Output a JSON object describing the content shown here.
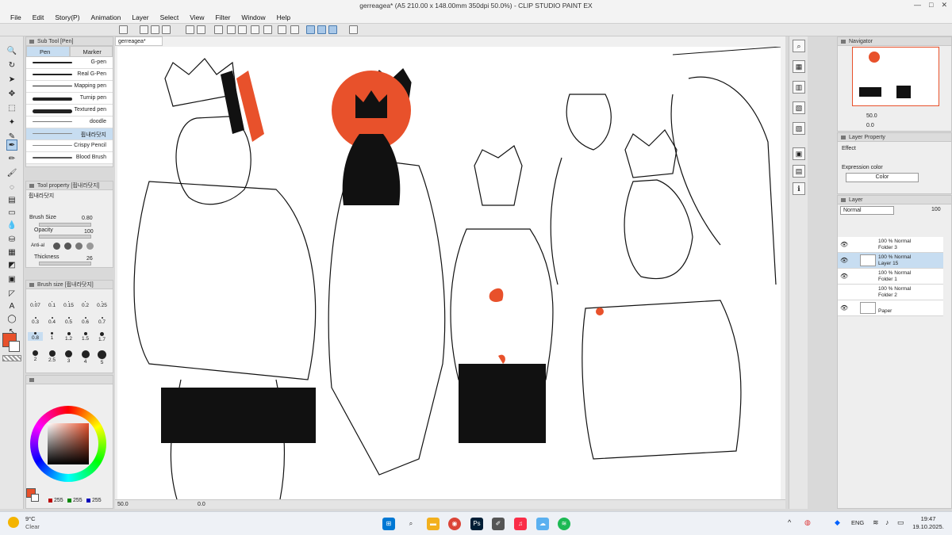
{
  "window": {
    "title": "gerreagea* (A5 210.00 x 148.00mm 350dpi 50.0%) - CLIP STUDIO PAINT EX",
    "controls": [
      "—",
      "□",
      "✕"
    ]
  },
  "menu": [
    "File",
    "Edit",
    "Story(P)",
    "Animation",
    "Layer",
    "Select",
    "View",
    "Filter",
    "Window",
    "Help"
  ],
  "subtool": {
    "panel_title": "Sub Tool [Pen]",
    "tabs": [
      "Pen",
      "Marker"
    ],
    "brushes": [
      "G-pen",
      "Real G-Pen",
      "Mapping pen",
      "Turnip pen",
      "Textured pen",
      "doodle",
      "휩내라닷지",
      "Crispy Pencil",
      "Blood Brush"
    ],
    "selected_index": 6
  },
  "tool_property": {
    "panel_title": "Tool property [휩내라닷지]",
    "name": "휩내라닷지",
    "brush_size_label": "Brush Size",
    "brush_size_value": "0.80",
    "opacity_label": "Opacity",
    "opacity_value": "100",
    "antialias_label": "Anti-al",
    "thickness_label": "Thickness",
    "thickness_value": "26"
  },
  "brush_size_panel": {
    "panel_title": "Brush size [휩내라닷지]",
    "sizes": [
      "0.07",
      "0.1",
      "0.15",
      "0.2",
      "0.25",
      "0.3",
      "0.4",
      "0.5",
      "0.6",
      "0.7",
      "0.8",
      "1",
      "1.2",
      "1.5",
      "1.7",
      "2",
      "2.5",
      "3",
      "4",
      "5"
    ],
    "selected": "0.8"
  },
  "color": {
    "main": "#e8512b",
    "rgb": {
      "r": "255",
      "g": "255",
      "b": "255"
    }
  },
  "document": {
    "tab": "gerreagea*",
    "zoom": "50.0",
    "rotation": "0.0"
  },
  "navigator": {
    "title": "Navigator",
    "zoom": "50.0",
    "rotation": "0.0"
  },
  "layer_property": {
    "title": "Layer Property",
    "effect_label": "Effect",
    "expression_color_label": "Expression color",
    "expression_color_value": "Color"
  },
  "layers": {
    "title": "Layer",
    "blend_mode": "Normal",
    "opacity": "100",
    "items": [
      {
        "line1": "100 % Normal",
        "line2": "Folder 3"
      },
      {
        "line1": "100 % Normal",
        "line2": "Layer 15"
      },
      {
        "line1": "100 % Normal",
        "line2": "Folder 1"
      },
      {
        "line1": "100 % Normal",
        "line2": "Folder 2"
      },
      {
        "line1": "",
        "line2": "Paper"
      }
    ],
    "selected_index": 1
  },
  "taskbar": {
    "weather_temp": "9°C",
    "weather_desc": "Clear",
    "language": "ENG",
    "time": "19:47",
    "date": "19.10.2025."
  },
  "colors": {
    "accent_orange": "#e8512b",
    "selection_blue": "#c7ddf1"
  }
}
